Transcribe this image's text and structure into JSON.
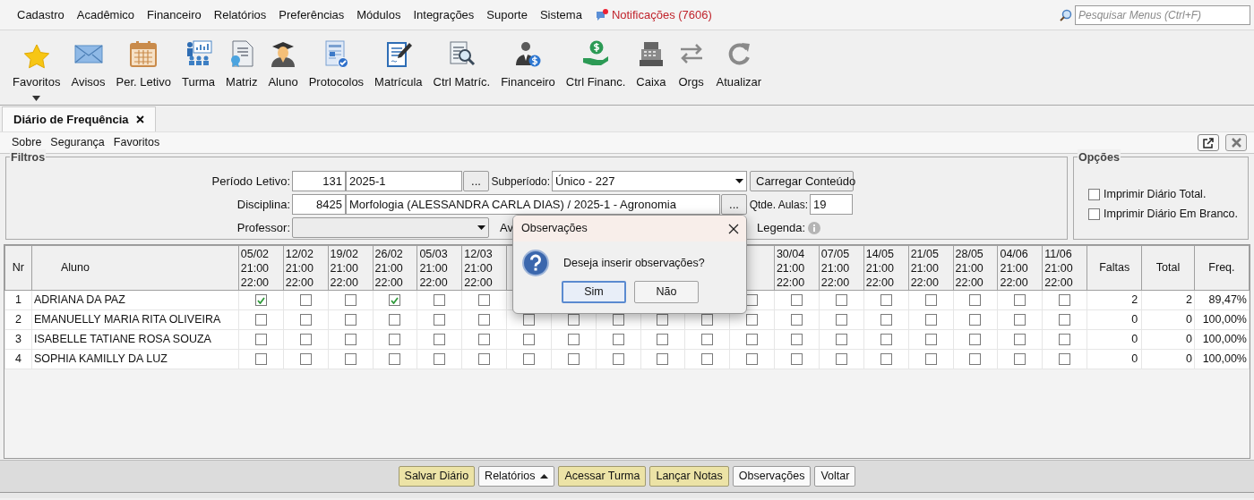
{
  "menu": [
    {
      "label": "Cadastro"
    },
    {
      "label": "Acadêmico"
    },
    {
      "label": "Financeiro"
    },
    {
      "label": "Relatórios"
    },
    {
      "label": "Preferências"
    },
    {
      "label": "Módulos"
    },
    {
      "label": "Integrações"
    },
    {
      "label": "Suporte"
    },
    {
      "label": "Sistema"
    }
  ],
  "notifications": {
    "label": "Notificações (7606)"
  },
  "search": {
    "placeholder": "Pesquisar Menus (Ctrl+F)"
  },
  "toolbar": [
    {
      "label": "Favoritos",
      "kind": "star"
    },
    {
      "label": "Avisos",
      "kind": "mail"
    },
    {
      "label": "Per. Letivo",
      "kind": "calendar"
    },
    {
      "label": "Turma",
      "kind": "class"
    },
    {
      "label": "Matriz",
      "kind": "certificate"
    },
    {
      "label": "Aluno",
      "kind": "student"
    },
    {
      "label": "Protocolos",
      "kind": "protocol"
    },
    {
      "label": "Matrícula",
      "kind": "contract"
    },
    {
      "label": "Ctrl Matríc.",
      "kind": "inspect"
    },
    {
      "label": "Financeiro",
      "kind": "person-money"
    },
    {
      "label": "Ctrl Financ.",
      "kind": "hand-money"
    },
    {
      "label": "Caixa",
      "kind": "register"
    },
    {
      "label": "Orgs",
      "kind": "swap"
    },
    {
      "label": "Atualizar",
      "kind": "refresh"
    }
  ],
  "tab": {
    "label": "Diário de Frequência",
    "selected": true
  },
  "submenu": [
    {
      "label": "Sobre"
    },
    {
      "label": "Segurança"
    },
    {
      "label": "Favoritos"
    }
  ],
  "filters": {
    "title": "Filtros",
    "periodo": {
      "label": "Período Letivo:",
      "code": "131",
      "value": "2025-1",
      "lookup": "..."
    },
    "subperiodo": {
      "label": "Subperíodo:",
      "value": "Único - 227"
    },
    "load_button": "Carregar Conteúdo",
    "disciplina": {
      "label": "Disciplina:",
      "code": "8425",
      "value": "Morfologia  (ALESSANDRA CARLA DIAS) / 2025-1 - Agronomia",
      "lookup": "..."
    },
    "qtde": {
      "label": "Qtde. Aulas:",
      "value": "19"
    },
    "professor": {
      "label": "Professor:"
    },
    "av_label": "Av",
    "legenda": {
      "label": "Legenda:"
    }
  },
  "options": {
    "title": "Opções",
    "items": [
      {
        "label": "Imprimir Diário Total.",
        "checked": false
      },
      {
        "label": "Imprimir Diário Em Branco.",
        "checked": false
      }
    ]
  },
  "table": {
    "nr": "Nr",
    "aluno": "Aluno",
    "faltas": "Faltas",
    "total": "Total",
    "freq": "Freq.",
    "dates_before": [
      {
        "date": "05/02",
        "start": "21:00",
        "end": "22:00"
      },
      {
        "date": "12/02",
        "start": "21:00",
        "end": "22:00"
      },
      {
        "date": "19/02",
        "start": "21:00",
        "end": "22:00"
      },
      {
        "date": "26/02",
        "start": "21:00",
        "end": "22:00"
      },
      {
        "date": "05/03",
        "start": "21:00",
        "end": "22:00"
      },
      {
        "date": "12/03",
        "start": "21:00",
        "end": "22:00"
      }
    ],
    "dates_after": [
      {
        "date": "30/04",
        "start": "21:00",
        "end": "22:00"
      },
      {
        "date": "07/05",
        "start": "21:00",
        "end": "22:00"
      },
      {
        "date": "14/05",
        "start": "21:00",
        "end": "22:00"
      },
      {
        "date": "21/05",
        "start": "21:00",
        "end": "22:00"
      },
      {
        "date": "28/05",
        "start": "21:00",
        "end": "22:00"
      },
      {
        "date": "04/06",
        "start": "21:00",
        "end": "22:00"
      },
      {
        "date": "11/06",
        "start": "21:00",
        "end": "22:00"
      }
    ],
    "rows": [
      {
        "nr": "1",
        "name": "ADRIANA DA PAZ",
        "faltas": "2",
        "total": "2",
        "freq": "89,47%",
        "cells_before": [
          {
            "checked": true
          },
          {
            "checked": false
          },
          {
            "checked": false
          },
          {
            "checked": true
          },
          {
            "checked": false
          },
          {
            "checked": false
          }
        ],
        "cells_after": [
          {
            "checked": false
          },
          {
            "checked": false
          },
          {
            "checked": false
          },
          {
            "checked": false
          },
          {
            "checked": false
          },
          {
            "checked": false
          },
          {
            "checked": false
          },
          {
            "checked": false
          }
        ]
      },
      {
        "nr": "2",
        "name": "EMANUELLY MARIA RITA OLIVEIRA",
        "faltas": "0",
        "total": "0",
        "freq": "100,00%",
        "cells_before": [
          {
            "checked": false
          },
          {
            "checked": false
          },
          {
            "checked": false
          },
          {
            "checked": false
          },
          {
            "checked": false
          },
          {
            "checked": false
          }
        ],
        "cells_after": [
          {
            "checked": false
          },
          {
            "checked": false
          },
          {
            "checked": false
          },
          {
            "checked": false
          },
          {
            "checked": false
          },
          {
            "checked": false
          },
          {
            "checked": false
          },
          {
            "checked": false
          },
          {
            "checked": false
          },
          {
            "checked": false
          },
          {
            "checked": false
          },
          {
            "checked": false
          },
          {
            "checked": false
          }
        ]
      },
      {
        "nr": "3",
        "name": "ISABELLE TATIANE ROSA SOUZA",
        "faltas": "0",
        "total": "0",
        "freq": "100,00%",
        "cells_before": [
          {
            "checked": false
          },
          {
            "checked": false
          },
          {
            "checked": false
          },
          {
            "checked": false
          },
          {
            "checked": false
          },
          {
            "checked": false
          }
        ],
        "cells_after": [
          {
            "checked": false
          },
          {
            "checked": false
          },
          {
            "checked": false
          },
          {
            "checked": false
          },
          {
            "checked": false
          },
          {
            "checked": false
          },
          {
            "checked": false
          },
          {
            "checked": false
          },
          {
            "checked": false
          },
          {
            "checked": false
          },
          {
            "checked": false
          },
          {
            "checked": false
          },
          {
            "checked": false
          }
        ]
      },
      {
        "nr": "4",
        "name": "SOPHIA KAMILLY DA LUZ",
        "faltas": "0",
        "total": "0",
        "freq": "100,00%",
        "cells_before": [
          {
            "checked": false
          },
          {
            "checked": false
          },
          {
            "checked": false
          },
          {
            "checked": false
          },
          {
            "checked": false
          },
          {
            "checked": false
          }
        ],
        "cells_after": [
          {
            "checked": false
          },
          {
            "checked": false
          },
          {
            "checked": false
          },
          {
            "checked": false
          },
          {
            "checked": false
          },
          {
            "checked": false
          },
          {
            "checked": false
          },
          {
            "checked": false
          },
          {
            "checked": false
          },
          {
            "checked": false
          },
          {
            "checked": false
          },
          {
            "checked": false
          },
          {
            "checked": false
          }
        ]
      }
    ]
  },
  "actions": [
    {
      "label": "Salvar Diário",
      "kind": "highlighted"
    },
    {
      "label": "Relatórios",
      "kind": "menu"
    },
    {
      "label": "Acessar Turma",
      "kind": "highlighted"
    },
    {
      "label": "Lançar Notas",
      "kind": "highlighted"
    },
    {
      "label": "Observações",
      "kind": "plain"
    },
    {
      "label": "Voltar",
      "kind": "plain"
    }
  ],
  "dialog": {
    "title": "Observações",
    "message": "Deseja inserir observações?",
    "buttons": [
      {
        "label": "Sim",
        "selected": true
      },
      {
        "label": "Não",
        "selected": false
      }
    ]
  }
}
